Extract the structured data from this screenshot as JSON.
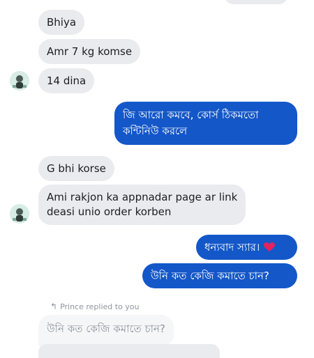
{
  "conversation": {
    "messages": [
      {
        "sender": "contact",
        "text": "Bhiya"
      },
      {
        "sender": "contact",
        "text": "Amr 7 kg komse"
      },
      {
        "sender": "contact",
        "text": "14 dina"
      },
      {
        "sender": "me",
        "lines": [
          "জি আরো কমবে, কোর্স ঠিকমতো",
          "কন্টিনিউ করলে"
        ]
      },
      {
        "sender": "contact",
        "text": "G bhi korse"
      },
      {
        "sender": "contact",
        "lines": [
          "Ami rakjon ka appnadar page ar link",
          "deasi unio order korben"
        ]
      },
      {
        "sender": "me",
        "text": "ধন্যবাদ স্যার।",
        "emoji": "heart"
      },
      {
        "sender": "me",
        "text": "উনি কত কেজি কমাতে চান?"
      }
    ],
    "reply": {
      "label": "Prince replied to you",
      "quoted_text": "উনি কত কেজি কমাতে চান?"
    }
  },
  "colors": {
    "incoming_bubble": "#e9ebee",
    "outgoing_bubble": "#1457c8",
    "heart": "#e0245e"
  }
}
